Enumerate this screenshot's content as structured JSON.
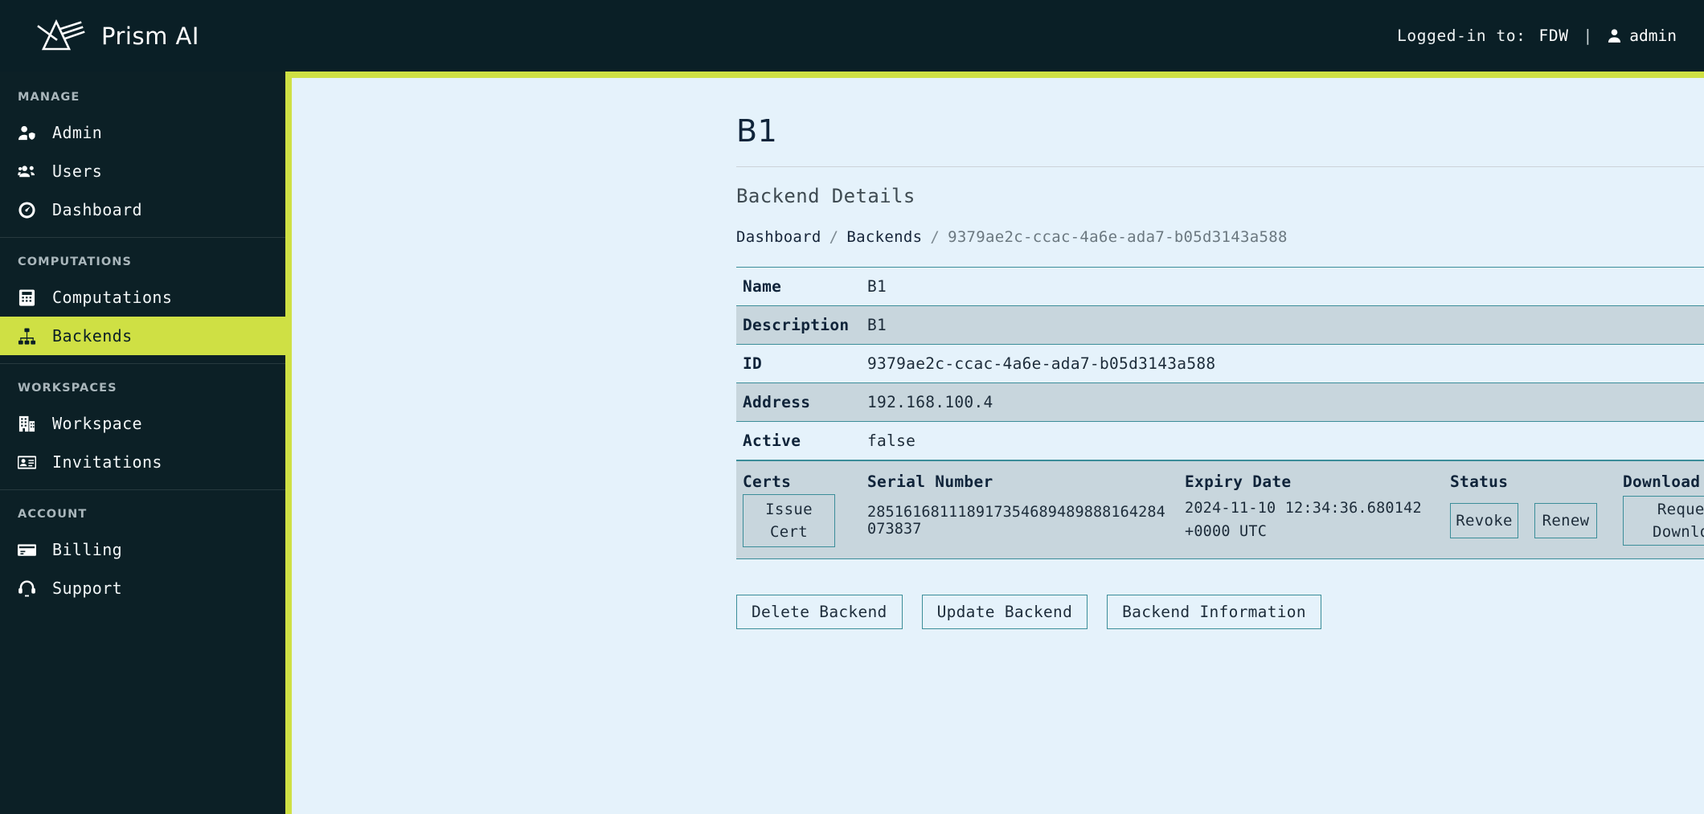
{
  "header": {
    "brand": "Prism AI",
    "logo_icon": "prism-logo-icon",
    "logged_in_label": "Logged-in to:",
    "tenant": "FDW",
    "separator": "|",
    "user_icon": "user-icon",
    "username": "admin"
  },
  "sidebar": {
    "groups": [
      {
        "title": "MANAGE",
        "items": [
          {
            "label": "Admin",
            "icon": "user-shield-icon",
            "active": false
          },
          {
            "label": "Users",
            "icon": "users-icon",
            "active": false
          },
          {
            "label": "Dashboard",
            "icon": "gauge-icon",
            "active": false
          }
        ]
      },
      {
        "title": "COMPUTATIONS",
        "items": [
          {
            "label": "Computations",
            "icon": "calculator-icon",
            "active": false
          },
          {
            "label": "Backends",
            "icon": "sitemap-icon",
            "active": true
          }
        ]
      },
      {
        "title": "WORKSPACES",
        "items": [
          {
            "label": "Workspace",
            "icon": "building-icon",
            "active": false
          },
          {
            "label": "Invitations",
            "icon": "id-card-icon",
            "active": false
          }
        ]
      },
      {
        "title": "ACCOUNT",
        "items": [
          {
            "label": "Billing",
            "icon": "credit-card-icon",
            "active": false
          },
          {
            "label": "Support",
            "icon": "headset-icon",
            "active": false
          }
        ]
      }
    ]
  },
  "main": {
    "page_title": "B1",
    "subtitle": "Backend Details",
    "breadcrumb": {
      "items": [
        "Dashboard",
        "Backends"
      ],
      "separator": "/",
      "current": "9379ae2c-ccac-4a6e-ada7-b05d3143a588"
    },
    "details": [
      {
        "key": "Name",
        "value": "B1"
      },
      {
        "key": "Description",
        "value": "B1"
      },
      {
        "key": "ID",
        "value": "9379ae2c-ccac-4a6e-ada7-b05d3143a588"
      },
      {
        "key": "Address",
        "value": "192.168.100.4"
      },
      {
        "key": "Active",
        "value": "false"
      }
    ],
    "certs": {
      "headers": {
        "certs": "Certs",
        "serial_number": "Serial Number",
        "expiry_date": "Expiry Date",
        "status": "Status",
        "download": "Download"
      },
      "issue_button": "Issue Cert",
      "rows": [
        {
          "serial_number": "285161681118917354689489888164284073837",
          "expiry_date": "2024-11-10 12:34:36.680142 +0000 UTC",
          "revoke_button": "Revoke",
          "renew_button": "Renew",
          "download_button": "Request Download"
        }
      ]
    },
    "actions": [
      {
        "label": "Delete Backend"
      },
      {
        "label": "Update Backend"
      },
      {
        "label": "Backend Information"
      }
    ]
  },
  "colors": {
    "sidebar_bg": "#0c2026",
    "topbar_bg": "#0a1f26",
    "accent_lime": "#cfe044",
    "content_bg": "#e5f2fb",
    "row_shade": "#c8d6dd",
    "border_teal": "#3b8d99",
    "text_dark": "#10243a"
  }
}
